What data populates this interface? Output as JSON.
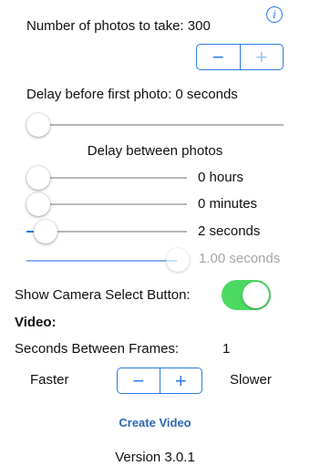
{
  "photos": {
    "label": "Number of photos to take: 300",
    "info_icon": "info-icon",
    "stepper": {
      "minus": "−",
      "plus": "+"
    }
  },
  "delay_first": {
    "label": "Delay before first photo: 0 seconds",
    "slider_value": 0
  },
  "delay_between": {
    "title": "Delay between photos",
    "hours": {
      "label": "0 hours",
      "value": 0
    },
    "minutes": {
      "label": "0 minutes",
      "value": 0
    },
    "seconds": {
      "label": "2 seconds",
      "value": 0.03
    },
    "fraction": {
      "label": "1.00 seconds",
      "value": 1.0
    }
  },
  "camera_select": {
    "label": "Show Camera Select Button:",
    "toggle_on": true,
    "toggle_color": "#4cd964"
  },
  "video": {
    "heading": "Video:",
    "seconds_label": "Seconds Between Frames:",
    "seconds_value": "1",
    "faster_label": "Faster",
    "slower_label": "Slower",
    "stepper": {
      "minus": "−",
      "plus": "+"
    },
    "create_label": "Create Video"
  },
  "version": "Version 3.0.1",
  "accent_color": "#2d7be5"
}
